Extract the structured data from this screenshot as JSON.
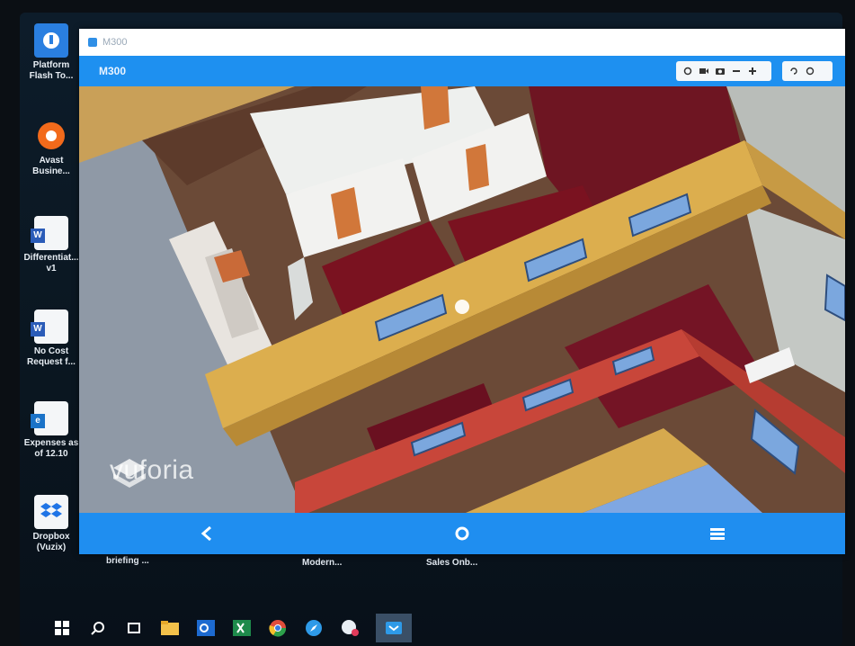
{
  "desktop": {
    "icons": [
      {
        "label": "Platform\nFlash To...",
        "icon": "platform-flash-tool-icon"
      },
      {
        "label": "Avast\nBusine...",
        "icon": "avast-icon"
      },
      {
        "label": "Differentiat...\nv1",
        "icon": "word-document-icon"
      },
      {
        "label": "No Cost\nRequest f...",
        "icon": "word-document-icon"
      },
      {
        "label": "Expenses as\nof 12.10",
        "icon": "pdf-document-icon"
      },
      {
        "label": "Dropbox\n(Vuzix)",
        "icon": "dropbox-icon"
      }
    ],
    "bottom_labels": [
      "briefing ...",
      "Modern...",
      "Sales Onb..."
    ]
  },
  "window": {
    "title": "M300",
    "appbar_title": "M300",
    "toolbar": {
      "group1": [
        "settings-icon",
        "video-icon",
        "camera-icon",
        "minus-icon",
        "plus-icon"
      ],
      "group2": [
        "rotate-icon",
        "record-icon"
      ]
    },
    "watermark": "vuforia",
    "nav": [
      "back-icon",
      "home-icon",
      "menu-icon"
    ]
  },
  "taskbar": {
    "items": [
      "start-icon",
      "search-icon",
      "task-view-icon",
      "file-explorer-icon",
      "outlook-icon",
      "excel-icon",
      "chrome-icon",
      "safari-icon",
      "chat-icon",
      "vysor-icon"
    ]
  },
  "colors": {
    "accent": "#1e90f0",
    "taskbar_bg": "#0b0f14",
    "floor_red": "#7a1220",
    "wall_yellow": "#dcae4e",
    "wall_red": "#c8463a",
    "window_blue": "#7ba7de"
  }
}
